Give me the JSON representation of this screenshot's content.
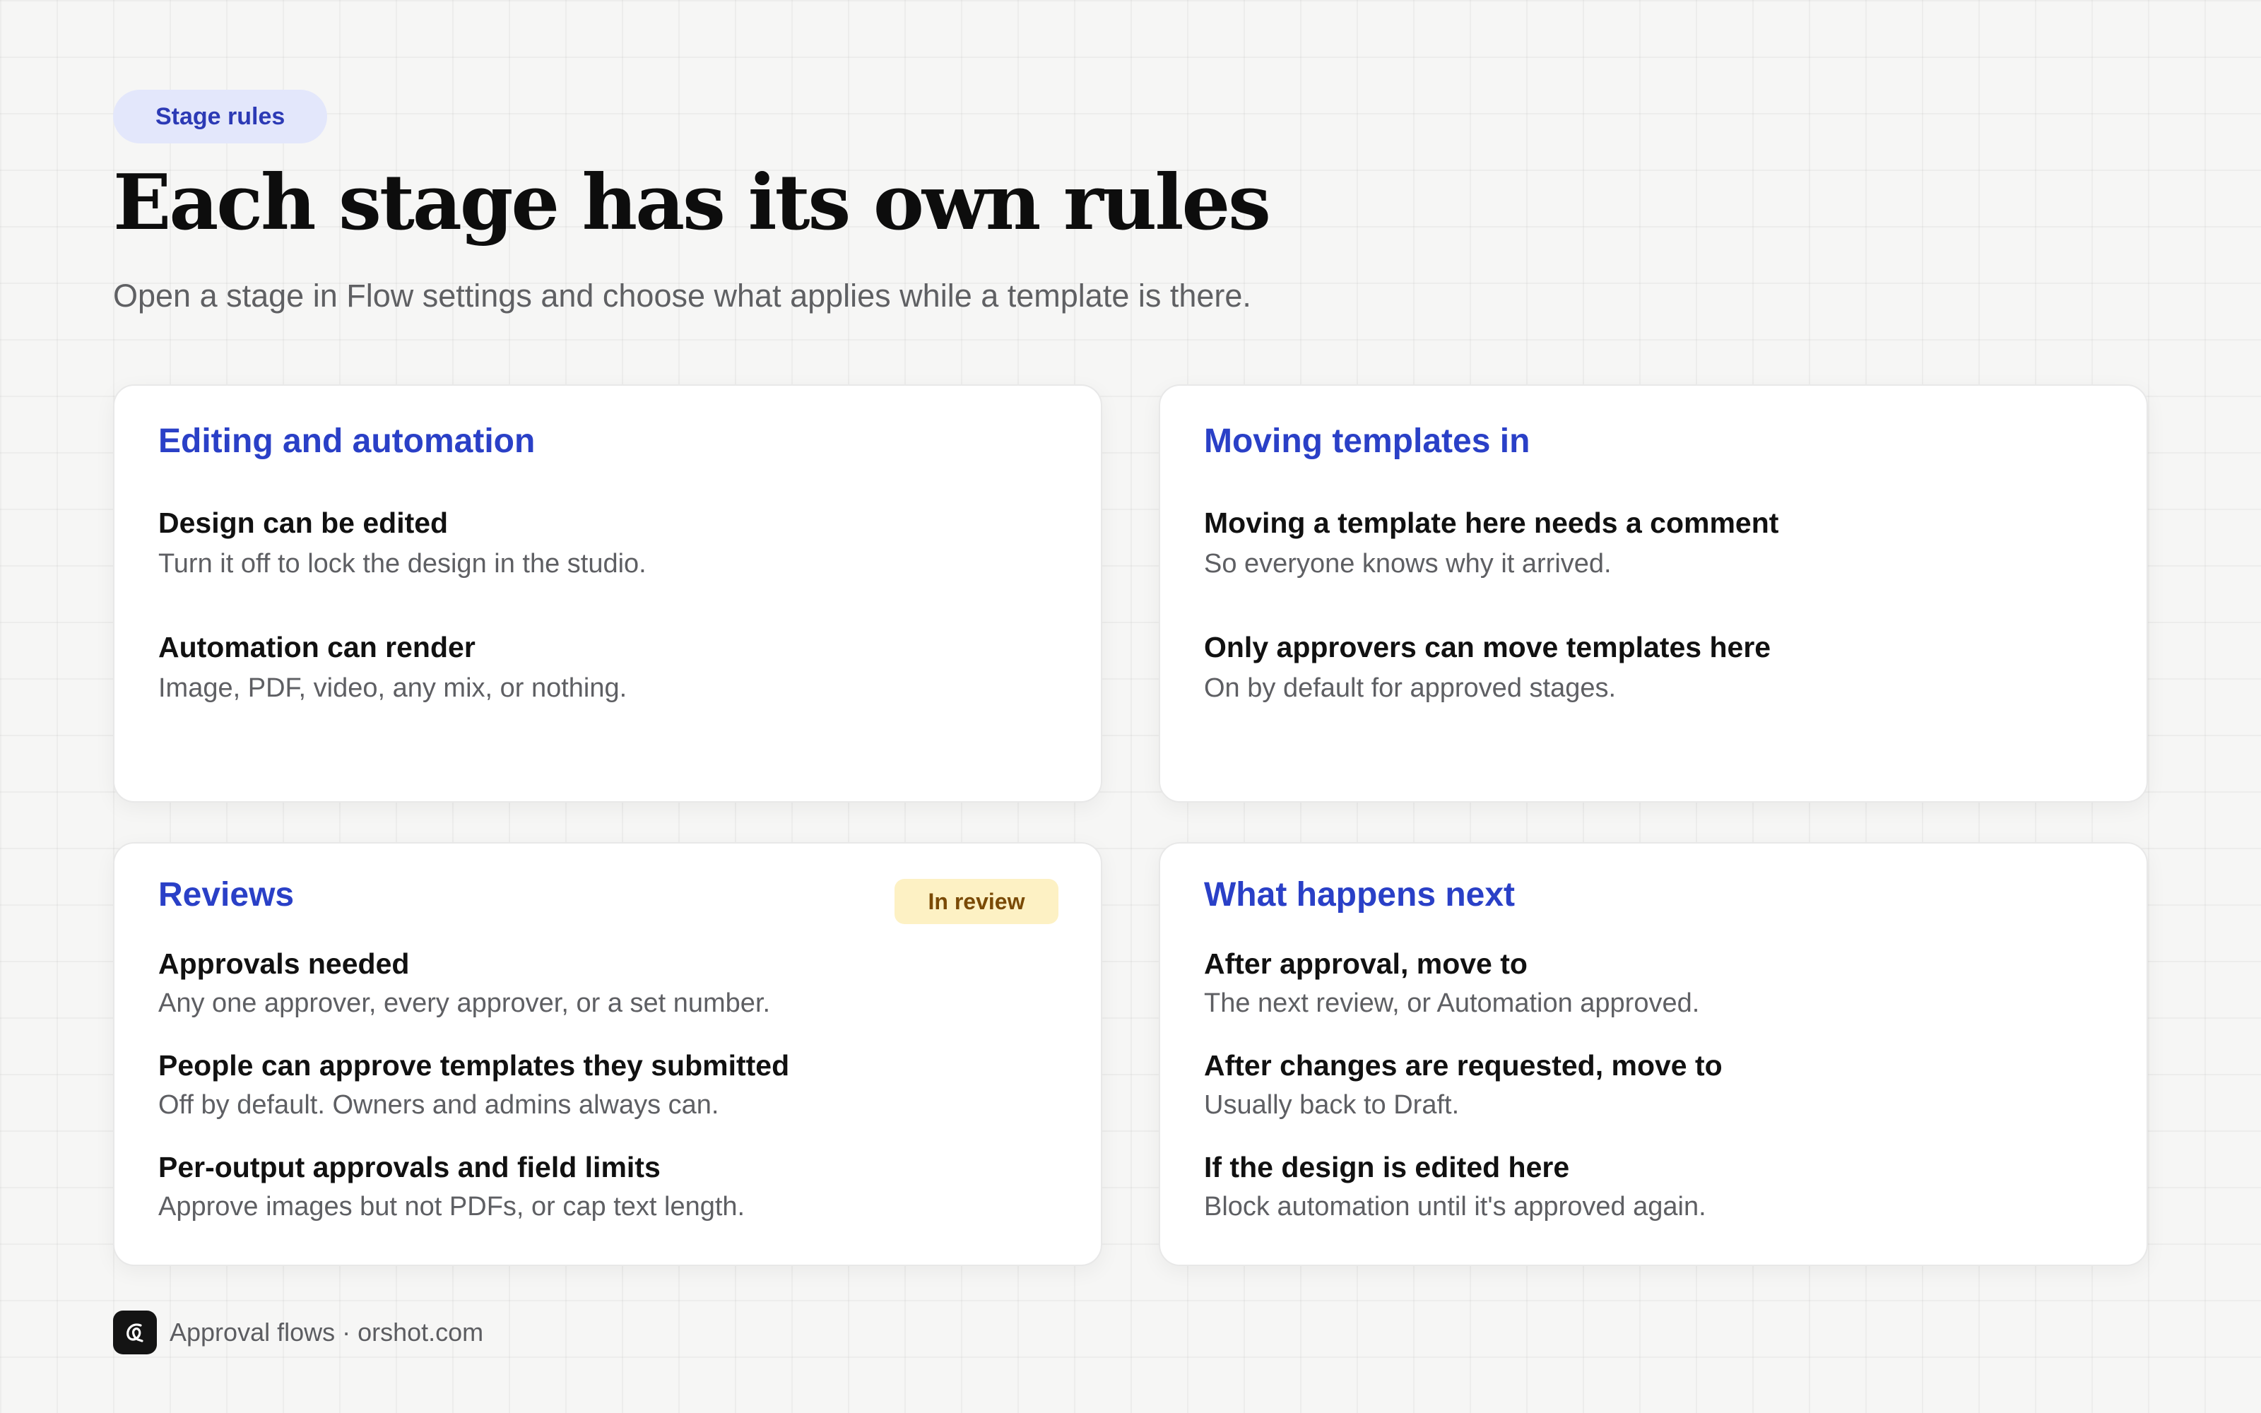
{
  "header": {
    "pill": "Stage rules",
    "title": "Each stage has its own rules",
    "subtitle": "Open a stage in Flow settings and choose what applies while a template is there."
  },
  "cards": [
    {
      "title": "Editing and automation",
      "items": [
        {
          "label": "Design can be edited",
          "desc": "Turn it off to lock the design in the studio."
        },
        {
          "label": "Automation can render",
          "desc": "Image, PDF, video, any mix, or nothing."
        }
      ]
    },
    {
      "title": "Moving templates in",
      "items": [
        {
          "label": "Moving a template here needs a comment",
          "desc": "So everyone knows why it arrived."
        },
        {
          "label": "Only approvers can move templates here",
          "desc": "On by default for approved stages."
        }
      ]
    },
    {
      "title": "Reviews",
      "badge": "In review",
      "items": [
        {
          "label": "Approvals needed",
          "desc": "Any one approver, every approver, or a set number."
        },
        {
          "label": "People can approve templates they submitted",
          "desc": "Off by default. Owners and admins always can."
        },
        {
          "label": "Per-output approvals and field limits",
          "desc": "Approve images but not PDFs, or cap text length."
        }
      ]
    },
    {
      "title": "What happens next",
      "items": [
        {
          "label": "After approval, move to",
          "desc": "The next review, or Automation approved."
        },
        {
          "label": "After changes are requested, move to",
          "desc": "Usually back to Draft."
        },
        {
          "label": "If the design is edited here",
          "desc": "Block automation until it's approved again."
        }
      ]
    }
  ],
  "footer": {
    "text": "Approval flows · orshot.com",
    "logo_icon": "orshot-logo-icon"
  },
  "colors": {
    "accent": "#2a40c7",
    "pill_bg": "#e3e7fb",
    "badge_bg": "#fdf1c4",
    "badge_text": "#7a4a06"
  }
}
